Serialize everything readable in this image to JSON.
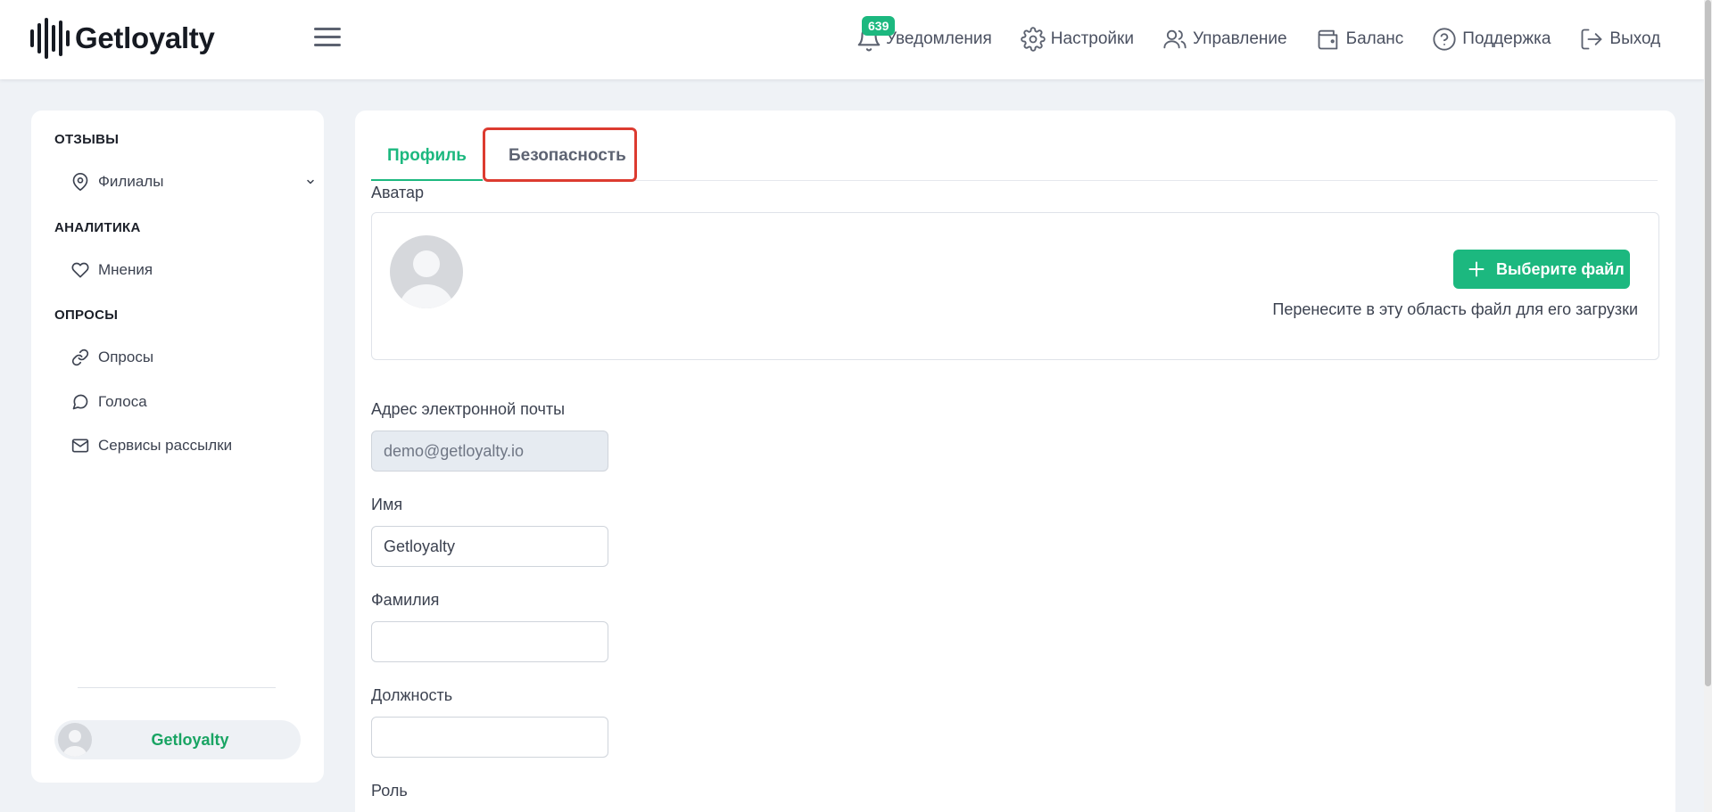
{
  "header": {
    "logo_text": "Getloyalty",
    "nav": {
      "notifications": {
        "label": "Уведомления",
        "badge": "639"
      },
      "settings": "Настройки",
      "management": "Управление",
      "balance": "Баланс",
      "support": "Поддержка",
      "logout": "Выход"
    }
  },
  "sidebar": {
    "sections": {
      "reviews": "ОТЗЫВЫ",
      "analytics": "АНАЛИТИКА",
      "surveys": "ОПРОСЫ"
    },
    "items": {
      "branches": "Филиалы",
      "opinions": "Мнения",
      "surveys": "Опросы",
      "votes": "Голоса",
      "mailing": "Сервисы рассылки"
    },
    "user_name": "Getloyalty"
  },
  "main": {
    "tabs": {
      "profile": "Профиль",
      "security": "Безопасность"
    },
    "avatar_label": "Аватар",
    "choose_file": "Выберите файл",
    "drop_hint": "Перенесите в эту область файл для его загрузки",
    "email": {
      "label": "Адрес электронной почты",
      "value": "demo@getloyalty.io"
    },
    "first_name": {
      "label": "Имя",
      "value": "Getloyalty"
    },
    "last_name": {
      "label": "Фамилия",
      "value": ""
    },
    "position": {
      "label": "Должность",
      "value": ""
    },
    "role": {
      "label": "Роль"
    }
  },
  "colors": {
    "accent": "#1cb87f",
    "highlight": "#dc3b30",
    "background": "#eff2f6"
  },
  "icons": {
    "menu": "hamburger-icon",
    "notifications": "bell-icon",
    "settings": "gear-icon",
    "management": "users-icon",
    "balance": "wallet-icon",
    "support": "question-circle-icon",
    "logout": "logout-icon",
    "branches": "map-pin-icon",
    "opinions": "heart-icon",
    "surveys": "link-icon",
    "votes": "chat-bubble-icon",
    "mailing": "envelope-icon",
    "choose_file": "plus-icon"
  }
}
